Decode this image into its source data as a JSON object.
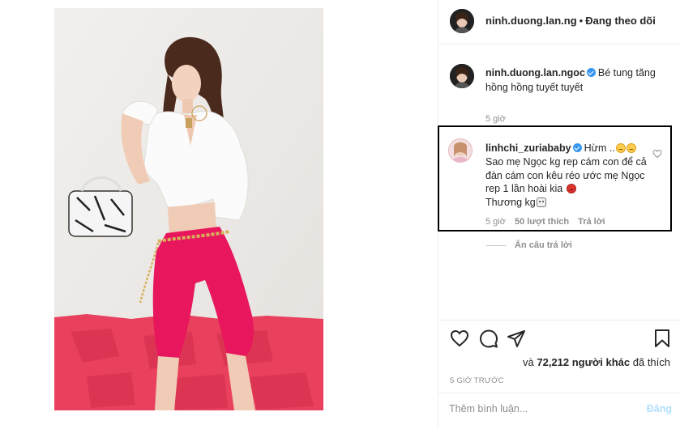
{
  "header": {
    "username": "ninh.duong.lan.ng",
    "separator": "•",
    "follow_status": "Đang theo dõi"
  },
  "caption": {
    "username": "ninh.duong.lan.ngoc",
    "text": "Bé tung tăng hồng hồng tuyết tuyết",
    "time": "5 giờ"
  },
  "comment": {
    "username": "linhchi_zuriababy",
    "line1": "Hừm ..",
    "line2": "Sao mẹ Ngọc kg rep cám con để cả đàn cám con kêu réo ước mẹ Ngọc rep 1 lần hoài kia",
    "line3": "Thương kg",
    "time": "5 giờ",
    "likes": "50 lượt thích",
    "reply": "Trả lời"
  },
  "hide_replies": "Ẩn câu trả lời",
  "post_actions": {
    "likes_prefix": "và",
    "likes_count": "72,212 người khác",
    "likes_suffix": "đã thích",
    "posted_time": "5 GIỜ TRƯỚC"
  },
  "add_comment": {
    "placeholder": "Thêm bình luận...",
    "post_label": "Đăng"
  },
  "icons": {
    "like": "heart-icon",
    "comment": "comment-icon",
    "share": "share-icon",
    "save": "bookmark-icon",
    "verified": "verified-badge-icon"
  },
  "colors": {
    "accent_blue": "#3897f0",
    "post_button_disabled": "#b2dffc",
    "secondary_text": "#8e8e8e",
    "photo_pink": "#e8175d"
  }
}
